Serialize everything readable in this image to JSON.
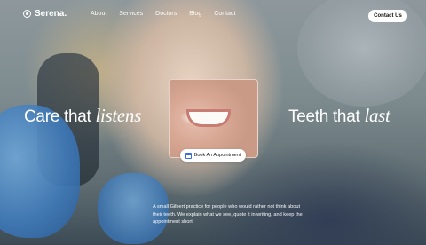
{
  "brand": {
    "name": "Serena."
  },
  "nav": {
    "links": [
      "About",
      "Services",
      "Doctors",
      "Blog",
      "Contact"
    ],
    "cta": "Contact Us"
  },
  "hero": {
    "left_plain": "Care that ",
    "left_italic": "listens",
    "right_plain": "Teeth that ",
    "right_italic": "last",
    "book_label": "Book An Appointment",
    "description": "A small Gilbert practice for people who would rather not think about their teeth. We explain what we see, quote it in writing, and keep the appointment short."
  }
}
